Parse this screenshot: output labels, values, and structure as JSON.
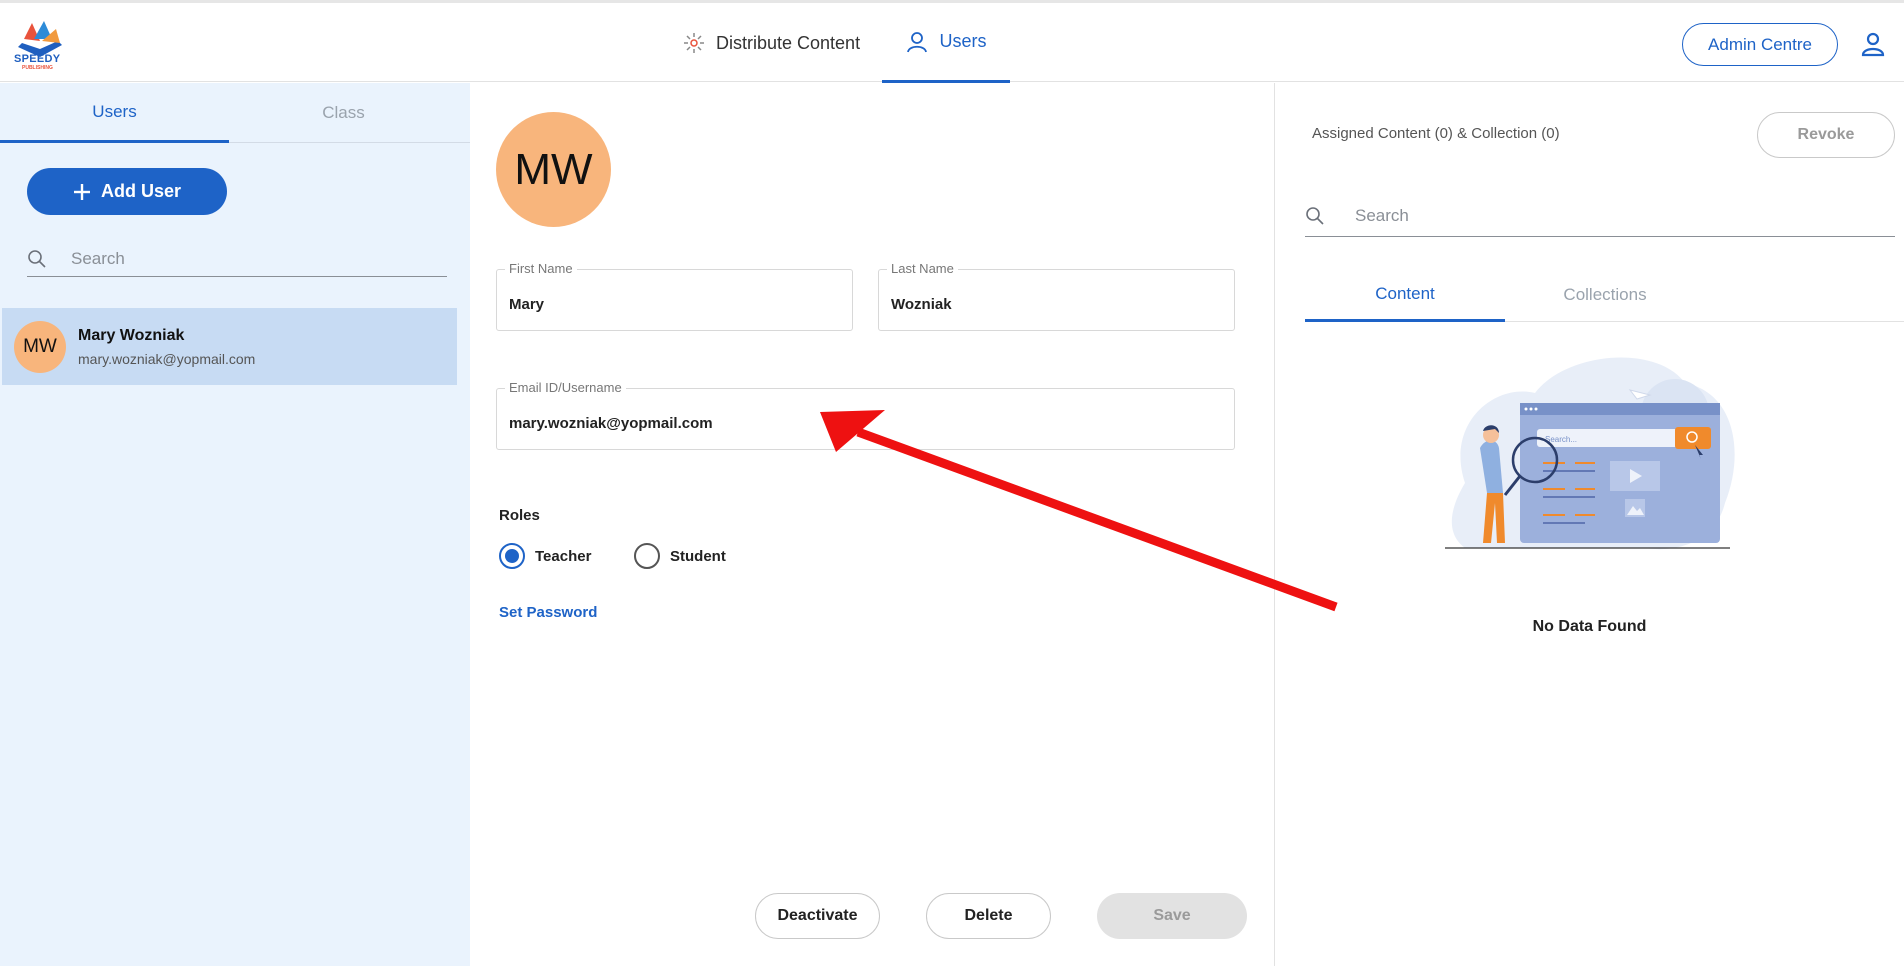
{
  "header": {
    "logo_text": "SPEEDY",
    "logo_sub": "PUBLISHING",
    "nav": [
      {
        "label": "Distribute Content",
        "icon": "distribute-icon"
      },
      {
        "label": "Users",
        "icon": "user-icon",
        "active": true
      }
    ],
    "admin_button": "Admin Centre",
    "profile_icon": "profile-icon"
  },
  "sidebar": {
    "tabs": [
      {
        "label": "Users",
        "active": true
      },
      {
        "label": "Class",
        "active": false
      }
    ],
    "add_user_label": "Add User",
    "search_placeholder": "Search",
    "users": [
      {
        "initials": "MW",
        "name": "Mary Wozniak",
        "email": "mary.wozniak@yopmail.com",
        "selected": true
      }
    ]
  },
  "main": {
    "avatar_initials": "MW",
    "first_name_label": "First Name",
    "first_name_value": "Mary",
    "last_name_label": "Last Name",
    "last_name_value": "Wozniak",
    "email_label": "Email ID/Username",
    "email_value": "mary.wozniak@yopmail.com",
    "roles_label": "Roles",
    "roles": [
      {
        "label": "Teacher",
        "selected": true
      },
      {
        "label": "Student",
        "selected": false
      }
    ],
    "set_password_label": "Set Password",
    "deactivate_label": "Deactivate",
    "delete_label": "Delete",
    "save_label": "Save"
  },
  "right_panel": {
    "title": "Assigned Content (0) & Collection (0)",
    "revoke_label": "Revoke",
    "search_placeholder": "Search",
    "tabs": [
      {
        "label": "Content",
        "active": true
      },
      {
        "label": "Collections",
        "active": false
      }
    ],
    "illustration_search_text": "Search...",
    "empty_text": "No Data Found"
  },
  "colors": {
    "accent": "#1e63c7",
    "avatar": "#f8b57c",
    "sidebar_bg": "#eaf3fd",
    "selected_row": "#c7dbf3",
    "annotation_arrow": "#ee1111"
  }
}
